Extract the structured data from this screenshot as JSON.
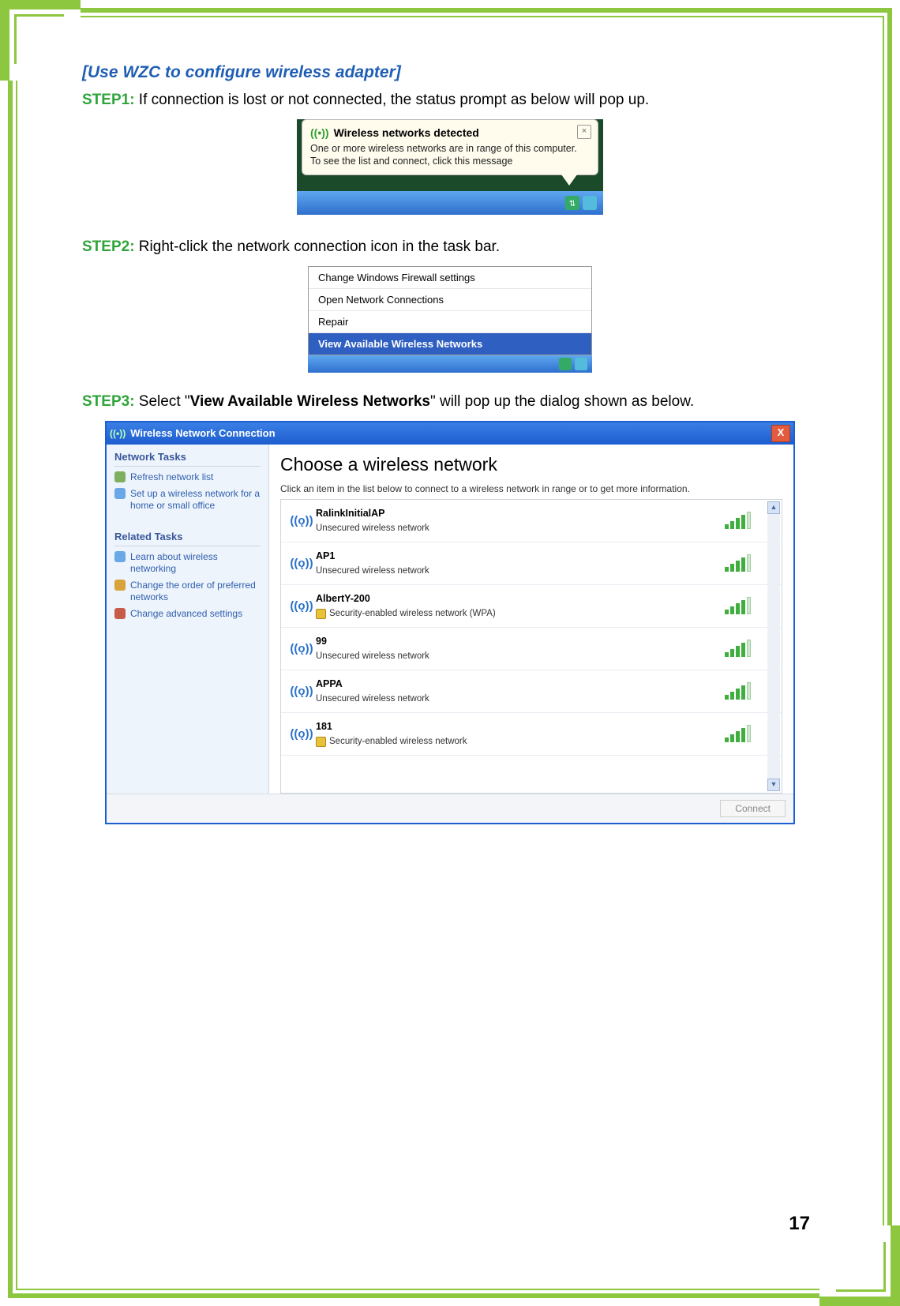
{
  "heading": "[Use WZC to configure wireless adapter]",
  "step1": {
    "label": "STEP1:",
    "text": " If connection is lost or not connected, the status prompt as below will pop up."
  },
  "balloon": {
    "title": "Wireless networks detected",
    "body": "One or more wireless networks are in range of this computer. To see the list and connect, click this message"
  },
  "step2": {
    "label": "STEP2:",
    "text": " Right-click the network connection icon in the task bar."
  },
  "context_menu": {
    "items": [
      "Change Windows Firewall settings",
      "Open Network Connections",
      "Repair",
      "View Available Wireless Networks"
    ],
    "selected_index": 3
  },
  "step3": {
    "label": "STEP3:",
    "pre": " Select \"",
    "bold": "View Available Wireless Networks",
    "post": "\" will pop up the dialog shown as below."
  },
  "dialog": {
    "title": "Wireless Network Connection",
    "side": {
      "network_tasks": "Network Tasks",
      "links1": [
        "Refresh network list",
        "Set up a wireless network for a home or small office"
      ],
      "related_tasks": "Related Tasks",
      "links2": [
        "Learn about wireless networking",
        "Change the order of preferred networks",
        "Change advanced settings"
      ]
    },
    "main_title": "Choose a wireless network",
    "hint": "Click an item in the list below to connect to a wireless network in range or to get more information.",
    "networks": [
      {
        "name": "RalinkInitialAP",
        "desc": "Unsecured wireless network",
        "secure": false
      },
      {
        "name": "AP1",
        "desc": "Unsecured wireless network",
        "secure": false
      },
      {
        "name": "AlbertY-200",
        "desc": "Security-enabled wireless network (WPA)",
        "secure": true
      },
      {
        "name": "99",
        "desc": "Unsecured wireless network",
        "secure": false
      },
      {
        "name": "APPA",
        "desc": "Unsecured wireless network",
        "secure": false
      },
      {
        "name": "181",
        "desc": "Security-enabled wireless network",
        "secure": true
      }
    ],
    "connect": "Connect"
  },
  "page_number": "17"
}
